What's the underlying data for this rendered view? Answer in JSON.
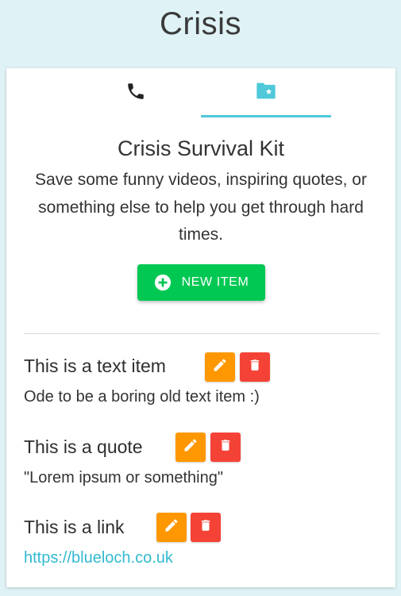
{
  "header": {
    "title": "Crisis"
  },
  "tabs": [
    {
      "icon": "phone-icon"
    },
    {
      "icon": "folder-star-icon",
      "active": true
    }
  ],
  "kit": {
    "title": "Crisis Survival Kit",
    "description": "Save some funny videos, inspiring quotes, or something else to help you get through hard times.",
    "new_item_label": "NEW ITEM"
  },
  "items": [
    {
      "title": "This is a text item",
      "body": "Ode to be a boring old text item :)"
    },
    {
      "title": "This is a quote",
      "body": "\"Lorem ipsum or something\""
    },
    {
      "title": "This is a link",
      "body": "https://blueloch.co.uk"
    }
  ],
  "colors": {
    "background": "#dff3f6",
    "accent": "#4fc9da",
    "new_button": "#00c853",
    "edit_button": "#ff9800",
    "delete_button": "#f44336",
    "link": "#32b9d0"
  }
}
